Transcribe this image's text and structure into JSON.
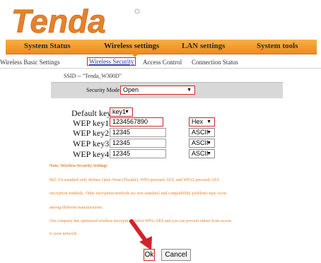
{
  "brand": {
    "logo_text": "Tenda",
    "logo_color": "#e7812a"
  },
  "main_tabs": [
    {
      "label": "System Status"
    },
    {
      "label": "Wireless settings"
    },
    {
      "label": "LAN settings"
    },
    {
      "label": "System tools"
    }
  ],
  "sub_tabs": [
    {
      "label": "Wireless Basic Settings"
    },
    {
      "label": "Wireless Security"
    },
    {
      "label": "Access Control"
    },
    {
      "label": "Connection Status"
    }
  ],
  "ssid_text": "SSID -- \"Tenda_W300D\"",
  "security_mode": {
    "label": "Security Mode",
    "value": "Open"
  },
  "default_key": {
    "label": "Default key",
    "value": "key1"
  },
  "wep_keys": [
    {
      "label": "WEP key1 :",
      "value": "1234567890",
      "format": "Hex"
    },
    {
      "label": "WEP key2 :",
      "value": "12345",
      "format": "ASCII"
    },
    {
      "label": "WEP key3 :",
      "value": "12345",
      "format": "ASCII"
    },
    {
      "label": "WEP key4 :",
      "value": "12345",
      "format": "ASCII"
    }
  ],
  "notes": [
    "Note: Wireless Security Settings",
    "802.11n standard only defines Open-None (Disable) ,WPA personal-AES, and WPA2 personal-AES",
    "encryption methods. Other encryption methods are non-standard, and compatibility problems may occur",
    "among different manufacturers.",
    "Our company has optimized wireless encryption. Select WPA-AES and you can prevent others from access",
    "to your network."
  ],
  "buttons": {
    "ok": "Ok",
    "cancel": "Cancel"
  },
  "colors": {
    "tab_bar": "#f19a2c",
    "highlight": "#d3232a",
    "note": "#e6822b"
  }
}
